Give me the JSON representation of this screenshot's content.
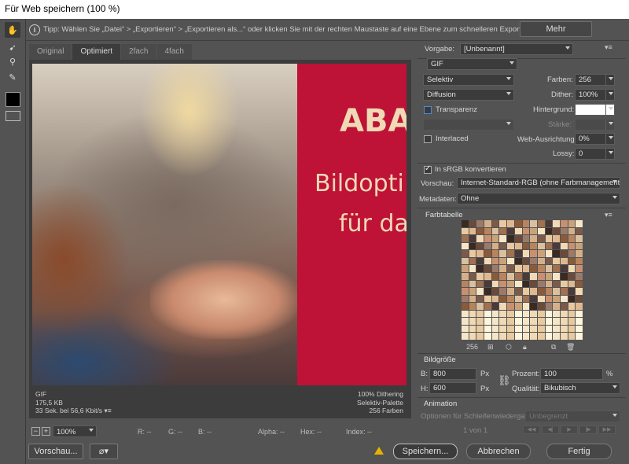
{
  "window": {
    "title": "Für Web speichern (100 %)"
  },
  "tools": [
    {
      "name": "hand-tool-icon",
      "glyph": "✋"
    },
    {
      "name": "slice-select-icon",
      "glyph": "➹"
    },
    {
      "name": "zoom-icon",
      "glyph": "⚲"
    },
    {
      "name": "eyedropper-icon",
      "glyph": "✎"
    }
  ],
  "tip": {
    "text": "Tipp: Wählen Sie „Datei“ > „Exportieren“ > „Exportieren als...“ oder klicken Sie mit der rechten Maustaste auf eine Ebene zum schnelleren Export von Elementen",
    "more_label": "Mehr"
  },
  "tabs": [
    "Original",
    "Optimiert",
    "2fach",
    "4fach"
  ],
  "active_tab": "Optimiert",
  "preview": {
    "banner_line1": "ABA",
    "banner_line2": "Bildopti",
    "banner_line3": "für da",
    "banner_color": "#bf1237"
  },
  "image_info": {
    "left": [
      "GIF",
      "175,5 KB",
      "33 Sek. bei 56,6 Kbit/s"
    ],
    "right": [
      "100% Dithering",
      "Selektiv-Palette",
      "256 Farben"
    ]
  },
  "statusbar": {
    "zoom": "100%",
    "r": "R: --",
    "g": "G: --",
    "b": "B: --",
    "alpha": "Alpha: --",
    "hex": "Hex: --",
    "index": "Index: --"
  },
  "buttons": {
    "preview": "Vorschau...",
    "save": "Speichern...",
    "cancel": "Abbrechen",
    "done": "Fertig"
  },
  "settings": {
    "preset_label": "Vorgabe:",
    "preset_value": "[Unbenannt]",
    "format": "GIF",
    "reduction": "Selektiv",
    "colors_label": "Farben:",
    "colors_value": "256",
    "dither_algo": "Diffusion",
    "dither_label": "Dither:",
    "dither_value": "100%",
    "transparency_label": "Transparenz",
    "transparency_checked": false,
    "matte_label": "Hintergrund:",
    "amount_label": "Stärke:",
    "interlaced_label": "Interlaced",
    "interlaced_checked": false,
    "websnap_label": "Web-Ausrichtung:",
    "websnap_value": "0%",
    "lossy_label": "Lossy:",
    "lossy_value": "0",
    "srgb_label": "In sRGB konvertieren",
    "srgb_checked": true,
    "preview_label": "Vorschau:",
    "preview_value": "Internet-Standard-RGB (ohne Farbmanagement)",
    "metadata_label": "Metadaten:",
    "metadata_value": "Ohne"
  },
  "color_table": {
    "title": "Farbtabelle",
    "count": "256",
    "palette": [
      "#3a2a22",
      "#8a5a3a",
      "#c9a27a",
      "#e8c9a0",
      "#f0d9b5",
      "#d4b08a",
      "#a07050",
      "#6a4a3a",
      "#b8845e",
      "#f5e6c8",
      "#e0b890",
      "#c89070",
      "#7a5a4a",
      "#4a3a3a",
      "#9a7a6a",
      "#d8c0a0"
    ],
    "count_cells": 256
  },
  "image_size": {
    "title": "Bildgröße",
    "w_label": "B:",
    "w_value": "800",
    "w_unit": "Px",
    "h_label": "H:",
    "h_value": "600",
    "h_unit": "Px",
    "percent_label": "Prozent:",
    "percent_value": "100",
    "percent_unit": "%",
    "quality_label": "Qualität:",
    "quality_value": "Bikubisch"
  },
  "animation": {
    "title": "Animation",
    "loop_label": "Optionen für Schleifenwiedergabe:",
    "loop_value": "Unbegrenzt",
    "frame": "1 von 1"
  }
}
